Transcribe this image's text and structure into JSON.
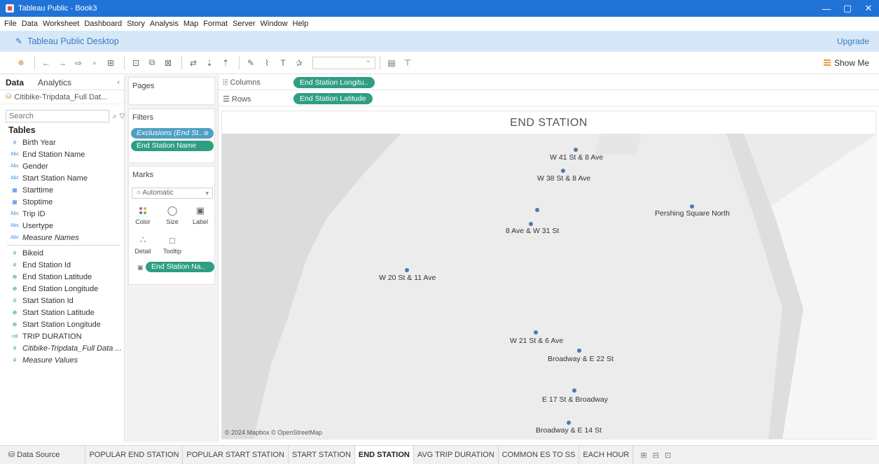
{
  "window": {
    "title": "Tableau Public - Book3",
    "minimize": "—",
    "restore": "▢",
    "close": "✕"
  },
  "menu": [
    "File",
    "Data",
    "Worksheet",
    "Dashboard",
    "Story",
    "Analysis",
    "Map",
    "Format",
    "Server",
    "Window",
    "Help"
  ],
  "banner": {
    "title": "Tableau Public Desktop",
    "upgrade": "Upgrade"
  },
  "toolbar": {
    "show_me": "Show Me"
  },
  "data_pane": {
    "tabs": {
      "data": "Data",
      "analytics": "Analytics"
    },
    "source": "Citibike-Tripdata_Full Dat...",
    "search_placeholder": "Search",
    "tables_header": "Tables",
    "dimensions": [
      {
        "type": "#",
        "name": "Birth Year"
      },
      {
        "type": "Abc",
        "name": "End Station Name"
      },
      {
        "type": "Abc",
        "name": "Gender"
      },
      {
        "type": "Abc",
        "name": "Start Station Name"
      },
      {
        "type": "date",
        "name": "Starttime"
      },
      {
        "type": "date",
        "name": "Stoptime"
      },
      {
        "type": "Abc",
        "name": "Trip ID"
      },
      {
        "type": "Abc",
        "name": "Usertype"
      },
      {
        "type": "Abc",
        "name": "Measure Names",
        "italic": true
      }
    ],
    "measures": [
      {
        "type": "#",
        "name": "Bikeid"
      },
      {
        "type": "#",
        "name": "End Station Id"
      },
      {
        "type": "geo",
        "name": "End Station Latitude"
      },
      {
        "type": "geo",
        "name": "End Station Longitude"
      },
      {
        "type": "#",
        "name": "Start Station Id"
      },
      {
        "type": "geo",
        "name": "Start Station Latitude"
      },
      {
        "type": "geo",
        "name": "Start Station Longitude"
      },
      {
        "type": "=#",
        "name": "TRIP DURATION"
      },
      {
        "type": "#",
        "name": "Citibike-Tripdata_Full Data ...",
        "italic": true
      },
      {
        "type": "#",
        "name": "Measure Values",
        "italic": true
      }
    ]
  },
  "pages": {
    "title": "Pages"
  },
  "filters": {
    "title": "Filters",
    "pills": [
      "Exclusions (End St..",
      "End Station Name"
    ]
  },
  "marks": {
    "title": "Marks",
    "type": "Automatic",
    "buttons": [
      "Color",
      "Size",
      "Label",
      "Detail",
      "Tooltip"
    ],
    "label_pill": "End Station Na.."
  },
  "shelves": {
    "columns_label": "Columns",
    "columns_pill": "End Station Longitu..",
    "rows_label": "Rows",
    "rows_pill": "End Station Latitude"
  },
  "viz": {
    "title": "END STATION",
    "attribution": "© 2024 Mapbox © OpenStreetMap",
    "stations": [
      {
        "name": "W 41 St & 8 Ave"
      },
      {
        "name": "W 38 St & 8 Ave"
      },
      {
        "name": "Pershing Square North"
      },
      {
        "name": ""
      },
      {
        "name": "8 Ave & W 31 St"
      },
      {
        "name": "W 20 St & 11 Ave"
      },
      {
        "name": "W 21 St & 6 Ave"
      },
      {
        "name": "Broadway & E 22 St"
      },
      {
        "name": "E 17 St & Broadway"
      },
      {
        "name": "Broadway & E 14 St"
      }
    ]
  },
  "sheets": {
    "data_source": "Data Source",
    "tabs": [
      "POPULAR END STATION",
      "POPULAR START STATION",
      "START STATION",
      "END STATION",
      "AVG TRIP DURATION",
      "COMMON ES TO SS",
      "EACH HOUR"
    ],
    "active": "END STATION"
  }
}
